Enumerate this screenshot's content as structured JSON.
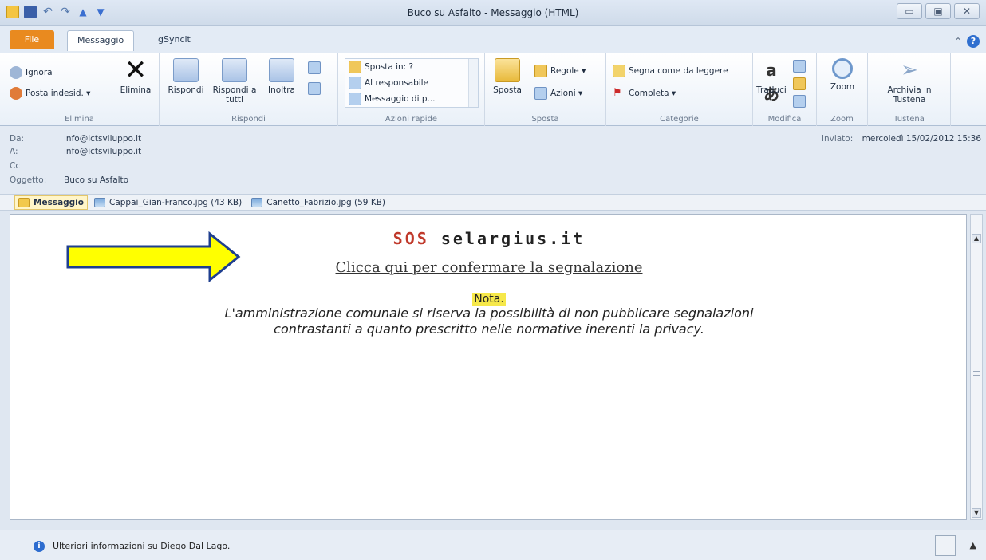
{
  "window": {
    "title": "Buco su Asfalto - Messaggio (HTML)",
    "controls": [
      "▭",
      "▣",
      "✕"
    ]
  },
  "tabs": {
    "file": "File",
    "message": "Messaggio",
    "gsyncit": "gSyncit"
  },
  "ribbon": {
    "delete_group": {
      "ignore": "Ignora",
      "junk": "Posta indesid. ▾",
      "delete": "Elimina",
      "label": "Elimina"
    },
    "respond_group": {
      "reply": "Rispondi",
      "reply_all": "Rispondi a tutti",
      "forward": "Inoltra",
      "label": "Rispondi"
    },
    "quick_steps": {
      "items": [
        "Sposta in: ?",
        "Al responsabile",
        "Messaggio di p..."
      ],
      "label": "Azioni rapide"
    },
    "move_group": {
      "move": "Sposta",
      "rules": "Regole ▾",
      "actions": "Azioni ▾",
      "label": "Sposta"
    },
    "tags_group": {
      "mark_read": "Segna come da leggere",
      "follow_up": "Completa ▾",
      "label": "Categorie"
    },
    "edit_group": {
      "translate": "Traduci",
      "label": "Modifica"
    },
    "zoom_group": {
      "zoom": "Zoom",
      "label": "Zoom"
    },
    "tustena_group": {
      "archive": "Archivia in Tustena",
      "label": "Tustena"
    }
  },
  "header": {
    "from_label": "Da:",
    "from": "info@ictsviluppo.it",
    "to_label": "A:",
    "to": "info@ictsviluppo.it",
    "cc_label": "Cc",
    "subject_label": "Oggetto:",
    "subject": "Buco su Asfalto",
    "sent_label": "Inviato:",
    "sent": "mercoledì 15/02/2012 15:36"
  },
  "attachments": {
    "message_tab": "Messaggio",
    "files": [
      "Cappai_Gian-Franco.jpg (43 KB)",
      "Canetto_Fabrizio.jpg (59 KB)"
    ]
  },
  "body": {
    "brand_sos": "SOS",
    "brand_rest": "selargius.it",
    "confirm_link": "Clicca qui per confermare la segnalazione",
    "note_title": "Nota.",
    "note_line1": "L'amministrazione comunale si riserva la possibilità di non pubblicare segnalazioni",
    "note_line2": "contrastanti a quanto prescritto nelle normative inerenti la privacy."
  },
  "status": {
    "message": "Ulteriori informazioni su Diego Dal Lago."
  },
  "colors": {
    "file_tab": "#e98a1f",
    "arrow_fill": "#ffff00",
    "arrow_stroke": "#1f3f8f",
    "brand_red": "#c0392b",
    "note_highlight": "#f6e84a"
  }
}
